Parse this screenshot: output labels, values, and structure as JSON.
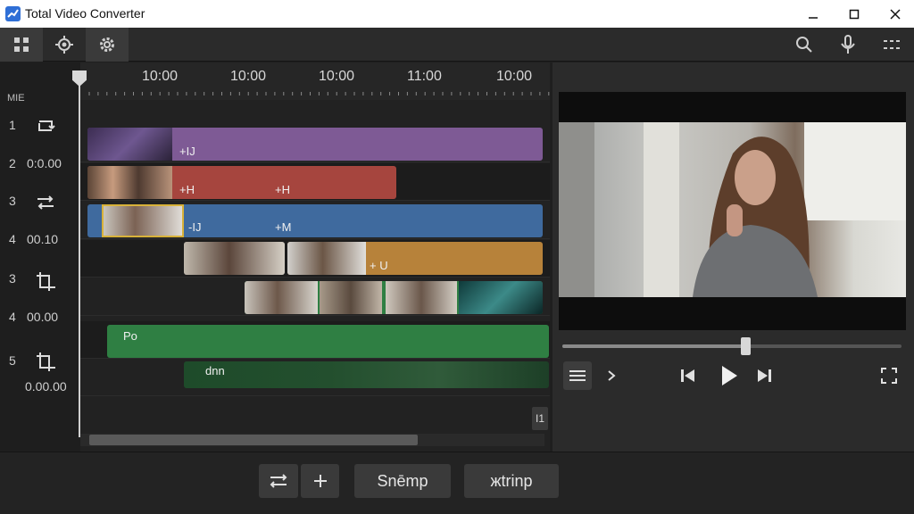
{
  "window": {
    "title": "Total Video Converter"
  },
  "ruler": {
    "tick_labels": [
      "10:00",
      "10:00",
      "10:00",
      "11:00",
      "10:00"
    ],
    "corner_label": "MIE"
  },
  "rows": [
    {
      "number": "1",
      "time": ""
    },
    {
      "number": "2",
      "time": "0:0.00"
    },
    {
      "number": "3",
      "time": ""
    },
    {
      "number": "4",
      "time": "00.10"
    },
    {
      "number": "3",
      "time": ""
    },
    {
      "number": "4",
      "time": "00.00"
    },
    {
      "number": "5",
      "time": ""
    },
    {
      "number": "",
      "time": "0.00.00"
    }
  ],
  "clips": {
    "purple": {
      "label": "+IJ"
    },
    "red": {
      "label_a": "+H",
      "label_b": "+H"
    },
    "blue": {
      "label_a": "-IJ",
      "label_b": "+M"
    },
    "orange": {
      "label": "+ U"
    },
    "green_audio": {
      "label": "Po"
    },
    "green_track": {
      "label": "dnn"
    }
  },
  "bottom": {
    "button_a": "Snēmp",
    "button_b": "жtrinp"
  },
  "timeline_page_marker": "I1",
  "colors": {
    "purple": "#7e5a95",
    "red": "#a6453e",
    "blue": "#3f6a9e",
    "orange": "#b7823a",
    "green": "#2f7f43",
    "dark_green": "#1e4b2a"
  }
}
